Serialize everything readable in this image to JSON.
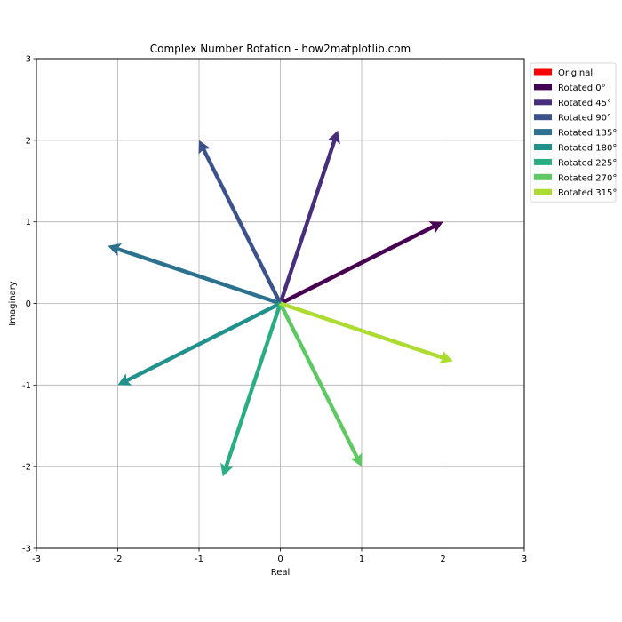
{
  "chart_data": {
    "type": "quiver",
    "title": "Complex Number Rotation - how2matplotlib.com",
    "xlabel": "Real",
    "ylabel": "Imaginary",
    "xlim": [
      -3,
      3
    ],
    "ylim": [
      -3,
      3
    ],
    "xticks": [
      -3,
      -2,
      -1,
      0,
      1,
      2,
      3
    ],
    "yticks": [
      -3,
      -2,
      -1,
      0,
      1,
      2,
      3
    ],
    "xtick_labels": [
      "-3",
      "-2",
      "-1",
      "0",
      "1",
      "2",
      "3"
    ],
    "ytick_labels": [
      "-3",
      "-2",
      "-1",
      "0",
      "1",
      "2",
      "3"
    ],
    "grid": true,
    "legend_position": "outside-top-right",
    "origin": [
      0,
      0
    ],
    "series": [
      {
        "name": "Original",
        "x": 2,
        "y": 1,
        "color": "#ff0000"
      },
      {
        "name": "Rotated 0°",
        "x": 2,
        "y": 1,
        "color": "#440154"
      },
      {
        "name": "Rotated 45°",
        "x": 0.707,
        "y": 2.121,
        "color": "#472d7b"
      },
      {
        "name": "Rotated 90°",
        "x": -1,
        "y": 2,
        "color": "#3b528b"
      },
      {
        "name": "Rotated 135°",
        "x": -2.121,
        "y": 0.707,
        "color": "#2c728e"
      },
      {
        "name": "Rotated 180°",
        "x": -2,
        "y": -1,
        "color": "#21918c"
      },
      {
        "name": "Rotated 225°",
        "x": -0.707,
        "y": -2.121,
        "color": "#28ae80"
      },
      {
        "name": "Rotated 270°",
        "x": 1,
        "y": -2,
        "color": "#5ec962"
      },
      {
        "name": "Rotated 315°",
        "x": 2.121,
        "y": -0.707,
        "color": "#addc30"
      }
    ]
  }
}
